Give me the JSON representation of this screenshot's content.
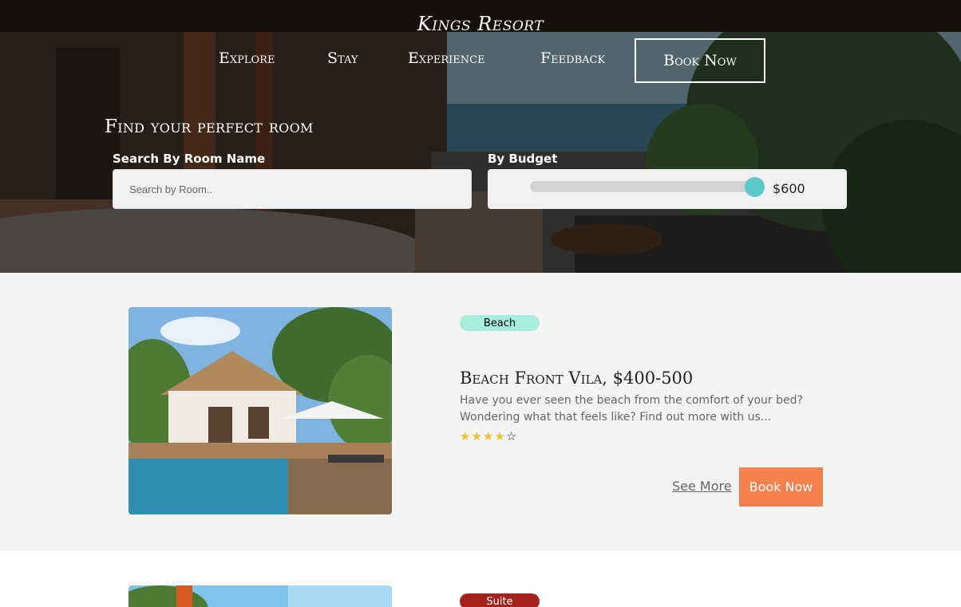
{
  "brand": {
    "name": "Kings Resort"
  },
  "nav": {
    "items": [
      "Explore",
      "Stay",
      "Experience",
      "Feedback"
    ],
    "book_label": "Book Now"
  },
  "search": {
    "title": "Find your perfect room",
    "room_label": "Search By Room Name",
    "room_placeholder": "Search by Room..",
    "budget_label": "By Budget",
    "budget_value": "$600",
    "budget_fraction": 0.98
  },
  "rooms": [
    {
      "tag": "Beach",
      "tag_color": "#a8eedc",
      "title": "Beach Front Vila, $400-500",
      "description": "Have you ever seen the beach from the comfort of your bed? Wondering what that feels like? Find out more with us...",
      "rating": 4,
      "rating_max": 5,
      "see_more_label": "See More",
      "book_label": "Book Now"
    },
    {
      "tag": "Suite",
      "tag_color": "#a3221c"
    }
  ],
  "colors": {
    "accent": "#f5814e",
    "slider_thumb": "#5bc8cc",
    "star": "#f0c030"
  }
}
